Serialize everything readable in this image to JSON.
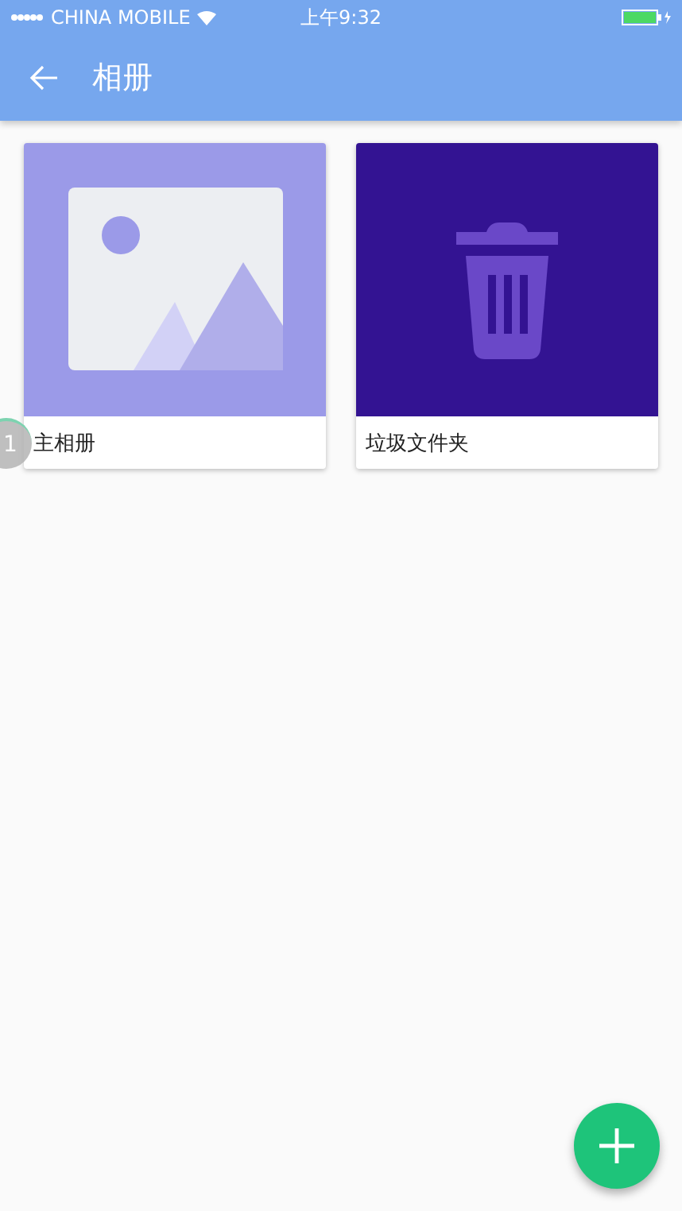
{
  "status_bar": {
    "carrier": "CHINA MOBILE",
    "time": "上午9:32",
    "battery": {
      "level": 1
    }
  },
  "app_bar": {
    "title": "相册"
  },
  "albums": [
    {
      "name": "主相册",
      "kind": "photos"
    },
    {
      "name": "垃圾文件夹",
      "kind": "trash"
    }
  ],
  "badge": "1"
}
